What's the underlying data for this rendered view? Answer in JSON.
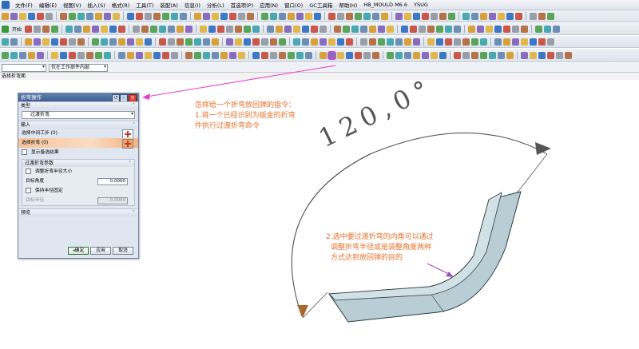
{
  "menubar": {
    "items": [
      "文件(F)",
      "编辑(E)",
      "视图(V)",
      "插入(S)",
      "格式(R)",
      "工具(T)",
      "装配(A)",
      "信息(I)",
      "分析(L)",
      "首选项(P)",
      "应用(N)",
      "窗口(O)",
      "GC工具箱",
      "帮助(H)",
      "HB_MOULD M6.6",
      "YSUG"
    ]
  },
  "toolbar": {
    "start_label": "开始",
    "highlight_marker": "1"
  },
  "selection_bar": {
    "filter_value": "",
    "scope_value": "仅在工作部件内部"
  },
  "status": {
    "prompt": "选择折弯面"
  },
  "dialog": {
    "title": "折弯操作",
    "sections": {
      "type": "类型",
      "type_value": "过渡折弯",
      "input": "输入",
      "select_intermediate": "选择中间工步 (0)",
      "select_bend": "选择折弯 (0)",
      "show_alternate": "显示备选结果",
      "bend_params": "过渡折弯参数",
      "adjust_radius": "调整折弯半径大小",
      "target_angle_label": "目标角度",
      "target_angle_value": "0.0000",
      "keep_radius": "保持半径固定",
      "target_radius_label": "目标半径",
      "target_radius_value": "0.0000",
      "preview": "预览"
    },
    "buttons": {
      "ok": "确定",
      "apply": "应用",
      "cancel": "取消"
    }
  },
  "annotations": {
    "note1_title": "怎样给一个折弯放回弹的指令：",
    "note1_line1": "1.将一个已经识别为钣金的折弯",
    "note1_line2": "件执行过渡折弯命令",
    "note2_line1": "2.选中要过渡折弯的内角可以通过",
    "note2_line2": "调整折弯半径或是调整角度两种",
    "note2_line3": "方式达到放回弹的目的",
    "dimension": "120,0°"
  },
  "colors": {
    "annotation": "#e8702a",
    "highlight": "#e63ecb",
    "part_face": "#b9cdd4",
    "part_edge": "#2a3a40"
  }
}
